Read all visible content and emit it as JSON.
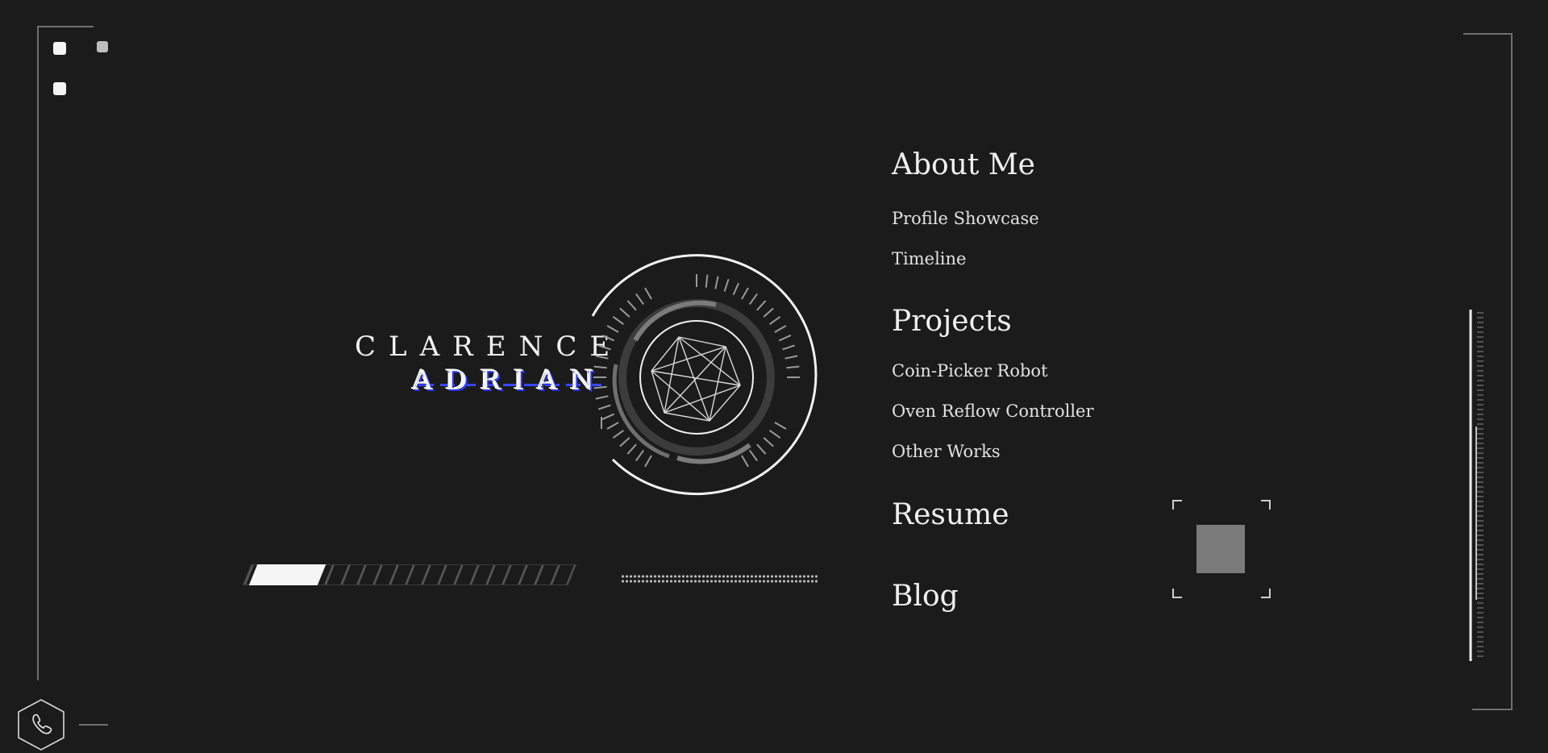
{
  "identity": {
    "first_name": "CLARENCE",
    "last_name": "ADRIAN"
  },
  "nav": {
    "sections": [
      {
        "label": "About Me",
        "items": [
          "Profile Showcase",
          "Timeline"
        ]
      },
      {
        "label": "Projects",
        "items": [
          "Coin-Picker Robot",
          "Oven Reflow Controller",
          "Other Works"
        ]
      },
      {
        "label": "Resume",
        "items": []
      },
      {
        "label": "Blog",
        "items": []
      }
    ]
  },
  "progress": {
    "value": 0.22
  },
  "icons": {
    "emblem": "polyhedron-emblem-icon",
    "contact": "phone-icon"
  },
  "colors": {
    "background": "#1b1b1b",
    "foreground": "#f0f0f0",
    "frame": "#6f6f6f",
    "glitch_accent": "#2a36ff"
  }
}
